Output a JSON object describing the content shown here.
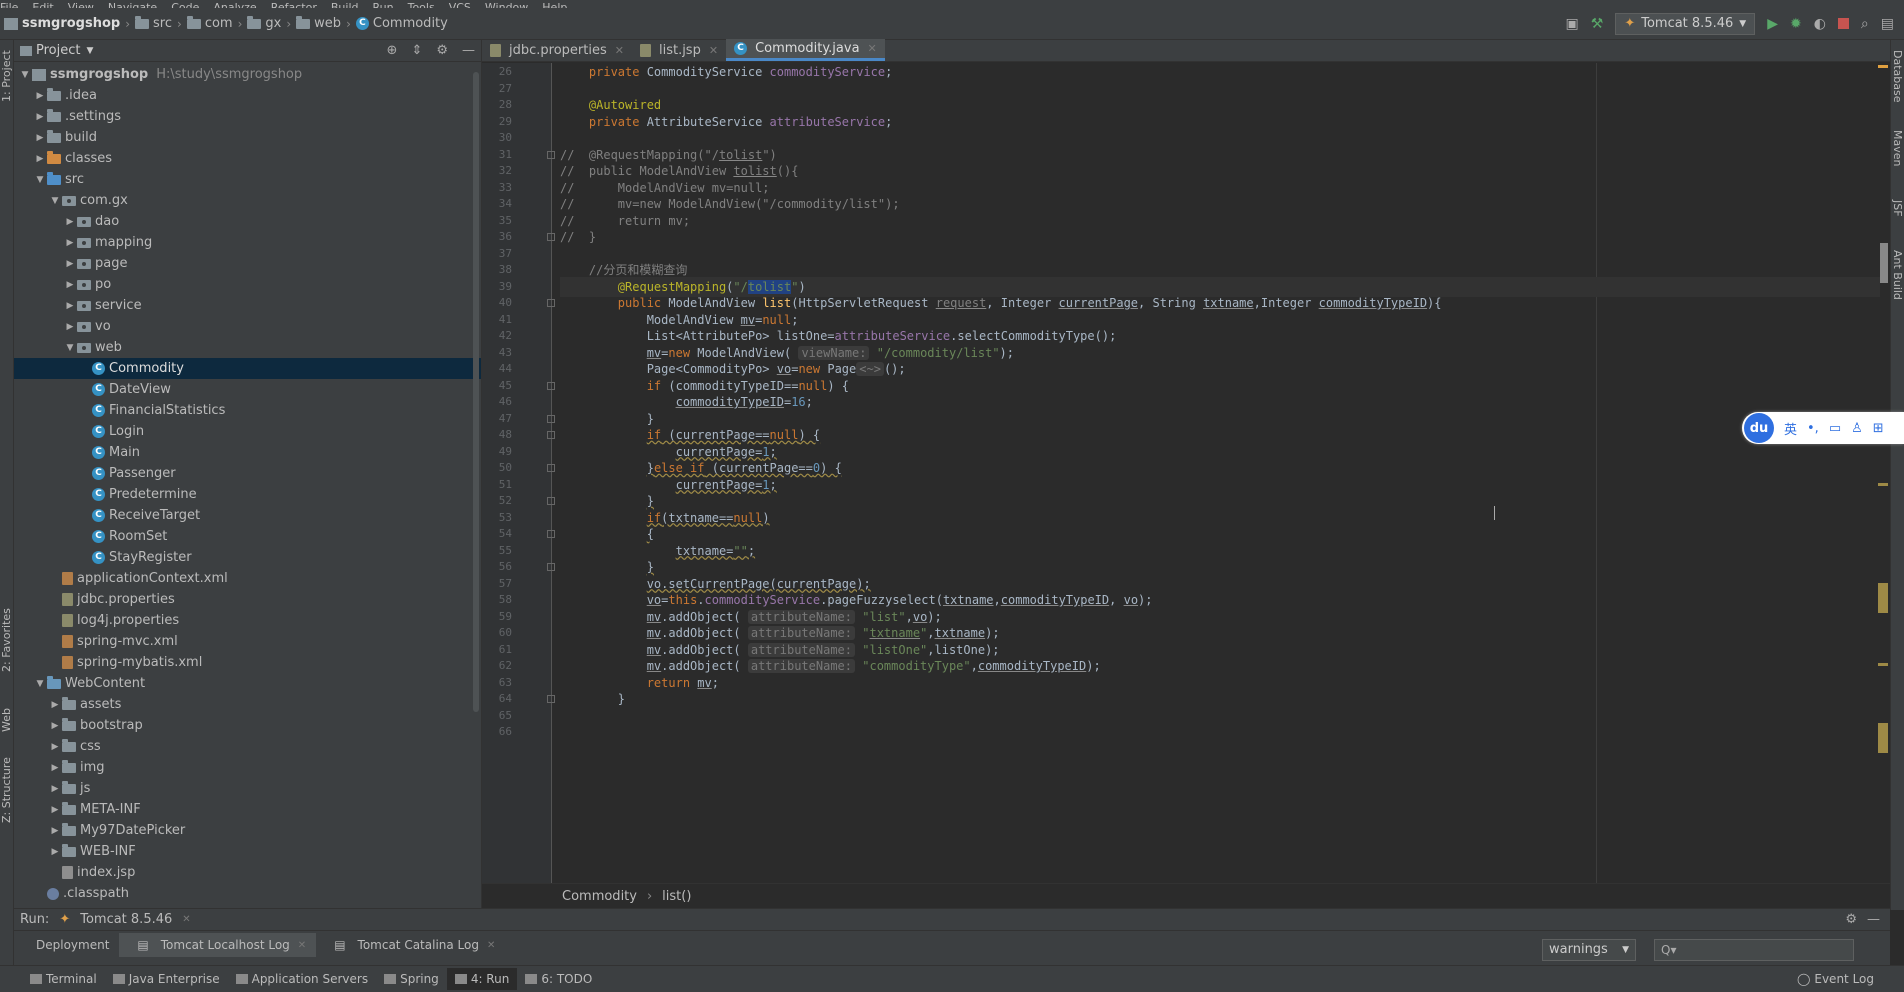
{
  "menu": [
    "File",
    "Edit",
    "View",
    "Navigate",
    "Code",
    "Analyze",
    "Refactor",
    "Build",
    "Run",
    "Tools",
    "VCS",
    "Window",
    "Help"
  ],
  "nav": {
    "crumbs": [
      {
        "label": "ssmgrogshop",
        "icon": "module-icon"
      },
      {
        "label": "src",
        "icon": "folder-icon"
      },
      {
        "label": "com",
        "icon": "folder-icon"
      },
      {
        "label": "gx",
        "icon": "folder-icon"
      },
      {
        "label": "web",
        "icon": "folder-icon"
      },
      {
        "label": "Commodity",
        "icon": "class-icon"
      }
    ],
    "run_config": "Tomcat 8.5.46"
  },
  "side_tabs_left": [
    "1: Project",
    "2: Favorites",
    "Web",
    "Z: Structure"
  ],
  "side_tabs_right": [
    "Database",
    "Maven",
    "JSF",
    "Ant Build"
  ],
  "project": {
    "title": "Project",
    "tree": [
      {
        "label": "ssmgrogshop",
        "path": "H:\\study\\ssmgrogshop",
        "level": 0,
        "arrow": "open",
        "icon": "module",
        "bold": true
      },
      {
        "label": ".idea",
        "level": 1,
        "arrow": "closed",
        "icon": "folder"
      },
      {
        "label": ".settings",
        "level": 1,
        "arrow": "closed",
        "icon": "folder"
      },
      {
        "label": "build",
        "level": 1,
        "arrow": "closed",
        "icon": "folder"
      },
      {
        "label": "classes",
        "level": 1,
        "arrow": "closed",
        "icon": "folder-orange"
      },
      {
        "label": "src",
        "level": 1,
        "arrow": "open",
        "icon": "folder-src"
      },
      {
        "label": "com.gx",
        "level": 2,
        "arrow": "open",
        "icon": "package"
      },
      {
        "label": "dao",
        "level": 3,
        "arrow": "closed",
        "icon": "package"
      },
      {
        "label": "mapping",
        "level": 3,
        "arrow": "closed",
        "icon": "package"
      },
      {
        "label": "page",
        "level": 3,
        "arrow": "closed",
        "icon": "package"
      },
      {
        "label": "po",
        "level": 3,
        "arrow": "closed",
        "icon": "package"
      },
      {
        "label": "service",
        "level": 3,
        "arrow": "closed",
        "icon": "package"
      },
      {
        "label": "vo",
        "level": 3,
        "arrow": "closed",
        "icon": "package"
      },
      {
        "label": "web",
        "level": 3,
        "arrow": "open",
        "icon": "package"
      },
      {
        "label": "Commodity",
        "level": 4,
        "arrow": "none",
        "icon": "class",
        "selected": true
      },
      {
        "label": "DateView",
        "level": 4,
        "arrow": "none",
        "icon": "class"
      },
      {
        "label": "FinancialStatistics",
        "level": 4,
        "arrow": "none",
        "icon": "class"
      },
      {
        "label": "Login",
        "level": 4,
        "arrow": "none",
        "icon": "class"
      },
      {
        "label": "Main",
        "level": 4,
        "arrow": "none",
        "icon": "class"
      },
      {
        "label": "Passenger",
        "level": 4,
        "arrow": "none",
        "icon": "class"
      },
      {
        "label": "Predetermine",
        "level": 4,
        "arrow": "none",
        "icon": "class"
      },
      {
        "label": "ReceiveTarget",
        "level": 4,
        "arrow": "none",
        "icon": "class"
      },
      {
        "label": "RoomSet",
        "level": 4,
        "arrow": "none",
        "icon": "class"
      },
      {
        "label": "StayRegister",
        "level": 4,
        "arrow": "none",
        "icon": "class"
      },
      {
        "label": "applicationContext.xml",
        "level": 2,
        "arrow": "none",
        "icon": "xml"
      },
      {
        "label": "jdbc.properties",
        "level": 2,
        "arrow": "none",
        "icon": "prop"
      },
      {
        "label": "log4j.properties",
        "level": 2,
        "arrow": "none",
        "icon": "prop"
      },
      {
        "label": "spring-mvc.xml",
        "level": 2,
        "arrow": "none",
        "icon": "xml"
      },
      {
        "label": "spring-mybatis.xml",
        "level": 2,
        "arrow": "none",
        "icon": "xml"
      },
      {
        "label": "WebContent",
        "level": 1,
        "arrow": "open",
        "icon": "folder-blue"
      },
      {
        "label": "assets",
        "level": 2,
        "arrow": "closed",
        "icon": "folder"
      },
      {
        "label": "bootstrap",
        "level": 2,
        "arrow": "closed",
        "icon": "folder"
      },
      {
        "label": "css",
        "level": 2,
        "arrow": "closed",
        "icon": "folder"
      },
      {
        "label": "img",
        "level": 2,
        "arrow": "closed",
        "icon": "folder"
      },
      {
        "label": "js",
        "level": 2,
        "arrow": "closed",
        "icon": "folder"
      },
      {
        "label": "META-INF",
        "level": 2,
        "arrow": "closed",
        "icon": "folder"
      },
      {
        "label": "My97DatePicker",
        "level": 2,
        "arrow": "closed",
        "icon": "folder"
      },
      {
        "label": "WEB-INF",
        "level": 2,
        "arrow": "closed",
        "icon": "folder"
      },
      {
        "label": "index.jsp",
        "level": 2,
        "arrow": "none",
        "icon": "jsp"
      },
      {
        "label": ".classpath",
        "level": 1,
        "arrow": "none",
        "icon": "cp"
      }
    ]
  },
  "editor": {
    "tabs": [
      {
        "label": "jdbc.properties",
        "active": false
      },
      {
        "label": "list.jsp",
        "active": false
      },
      {
        "label": "Commodity.java",
        "active": true
      }
    ],
    "breadcrumb": [
      "Commodity",
      "list()"
    ],
    "current_line": 39,
    "lines": [
      {
        "n": 26,
        "html": "    <span class=\"kw\">private</span> CommodityService <span class=\"fld\">commodityService</span>;"
      },
      {
        "n": 27,
        "html": ""
      },
      {
        "n": 28,
        "html": "    <span class=\"ann\">@Autowired</span>"
      },
      {
        "n": 29,
        "html": "    <span class=\"kw\">private</span> AttributeService <span class=\"fld\">attributeService</span>;"
      },
      {
        "n": 30,
        "html": ""
      },
      {
        "n": 31,
        "html": "<span class=\"cmt\">//  @RequestMapping(\"/<span class=\"ul\">tolist</span>\")</span>"
      },
      {
        "n": 32,
        "html": "<span class=\"cmt\">//  public ModelAndView <span class=\"ul\">tolist</span>(){</span>"
      },
      {
        "n": 33,
        "html": "<span class=\"cmt\">//      ModelAndView mv=null;</span>"
      },
      {
        "n": 34,
        "html": "<span class=\"cmt\">//      mv=new ModelAndView(\"/commodity/list\");</span>"
      },
      {
        "n": 35,
        "html": "<span class=\"cmt\">//      return mv;</span>"
      },
      {
        "n": 36,
        "html": "<span class=\"cmt\">//  }</span>"
      },
      {
        "n": 37,
        "html": ""
      },
      {
        "n": 38,
        "html": "    <span class=\"cmt\">//分页和模糊查询</span>"
      },
      {
        "n": 39,
        "html": "        <span class=\"ann\">@RequestMapping</span>(<span class=\"str\">\"/<span class=\"hl\">tolist</span>\"</span>)"
      },
      {
        "n": 40,
        "html": "        <span class=\"kw\">public</span> ModelAndView <span style=\"color:#ffc66d\">list</span>(HttpServletRequest <span class=\"ul\" style=\"color:#808080\">request</span>, Integer <span class=\"ul\">currentPage</span>, String <span class=\"ul\">txtname</span>,Integer <span class=\"ul\">commodityTypeID</span>){"
      },
      {
        "n": 41,
        "html": "            ModelAndView <span class=\"ul\">mv</span>=<span class=\"kw\">null</span>;"
      },
      {
        "n": 42,
        "html": "            List&lt;AttributePo&gt; listOne=<span class=\"fld\">attributeService</span>.selectCommodityType();"
      },
      {
        "n": 43,
        "html": "            <span class=\"ul\">mv</span>=<span class=\"kw\">new</span> ModelAndView( <span class=\"hint\">viewName:</span> <span class=\"str\">\"/commodity/list\"</span>);"
      },
      {
        "n": 44,
        "html": "            Page&lt;CommodityPo&gt; <span class=\"ul\">vo</span>=<span class=\"kw\">new</span> Page<span class=\"hint\">&lt;~&gt;</span>();"
      },
      {
        "n": 45,
        "html": "            <span class=\"kw\">if</span> (commodityTypeID==<span class=\"kw\">null</span>) {"
      },
      {
        "n": 46,
        "html": "                <span class=\"ul\">commodityTypeID</span>=<span class=\"num\">16</span>;"
      },
      {
        "n": 47,
        "html": "            }"
      },
      {
        "n": 48,
        "html": "            <span class=\"wrn\"><span class=\"kw\">if</span> (currentPage==<span class=\"kw\">null</span>) {</span>"
      },
      {
        "n": 49,
        "html": "                <span class=\"wrn\">currentPage=<span class=\"num\">1</span>;</span>"
      },
      {
        "n": 50,
        "html": "            <span class=\"wrn\">}<span class=\"kw\">else if</span> (currentPage==<span class=\"num\">0</span>) {</span>"
      },
      {
        "n": 51,
        "html": "                <span class=\"wrn\">currentPage=<span class=\"num\">1</span>;</span>"
      },
      {
        "n": 52,
        "html": "            <span class=\"wrn\">}</span>"
      },
      {
        "n": 53,
        "html": "            <span class=\"wrn\"><span class=\"kw\">if</span>(txtname==<span class=\"kw\">null</span>)</span>"
      },
      {
        "n": 54,
        "html": "            <span class=\"wrn\">{</span>"
      },
      {
        "n": 55,
        "html": "                <span class=\"wrn\">txtname=<span class=\"str\">\"\"</span>;</span>"
      },
      {
        "n": 56,
        "html": "            <span class=\"wrn\">}</span>"
      },
      {
        "n": 57,
        "html": "            <span class=\"wrn\">vo.setCurrentPage(currentPage);</span>"
      },
      {
        "n": 58,
        "html": "            <span class=\"ul\">vo</span>=<span class=\"kw\">this</span>.<span class=\"fld\">commodityService</span>.pageFuzzyselect(<span class=\"ul\">txtname</span>,<span class=\"ul\">commodityTypeID</span>, <span class=\"ul\">vo</span>);"
      },
      {
        "n": 59,
        "html": "            <span class=\"ul\">mv</span>.addObject( <span class=\"hint\">attributeName:</span> <span class=\"str\">\"list\"</span>,<span class=\"ul\">vo</span>);"
      },
      {
        "n": 60,
        "html": "            <span class=\"ul\">mv</span>.addObject( <span class=\"hint\">attributeName:</span> <span class=\"str\">\"<span class=\"ul\">txtname</span>\"</span>,<span class=\"ul\">txtname</span>);"
      },
      {
        "n": 61,
        "html": "            <span class=\"ul\">mv</span>.addObject( <span class=\"hint\">attributeName:</span> <span class=\"str\">\"listOne\"</span>,listOne);"
      },
      {
        "n": 62,
        "html": "            <span class=\"ul\">mv</span>.addObject( <span class=\"hint\">attributeName:</span> <span class=\"str\">\"commodityType\"</span>,<span class=\"ul\">commodityTypeID</span>);"
      },
      {
        "n": 63,
        "html": "            <span class=\"kw\">return</span> <span class=\"ul\">mv</span>;"
      },
      {
        "n": 64,
        "html": "        }"
      },
      {
        "n": 65,
        "html": ""
      },
      {
        "n": 66,
        "html": ""
      }
    ]
  },
  "ime": {
    "logo": "du",
    "lang": "英"
  },
  "run": {
    "label": "Run:",
    "config": "Tomcat 8.5.46",
    "tabs": [
      {
        "label": "Deployment",
        "active": false
      },
      {
        "label": "Tomcat Localhost Log",
        "active": true
      },
      {
        "label": "Tomcat Catalina Log",
        "active": false
      }
    ],
    "level_filter": "warnings",
    "search_placeholder": "Q▾"
  },
  "toolwindows": [
    {
      "label": "Terminal",
      "active": false
    },
    {
      "label": "Java Enterprise",
      "active": false
    },
    {
      "label": "Application Servers",
      "active": false
    },
    {
      "label": "Spring",
      "active": false
    },
    {
      "label": "4: Run",
      "active": true
    },
    {
      "label": "6: TODO",
      "active": false
    }
  ],
  "event_log": "Event Log",
  "colors": {
    "accent": "#4a88c7",
    "selection": "#0d293e",
    "keyword": "#cc7832",
    "string": "#6a8759"
  }
}
